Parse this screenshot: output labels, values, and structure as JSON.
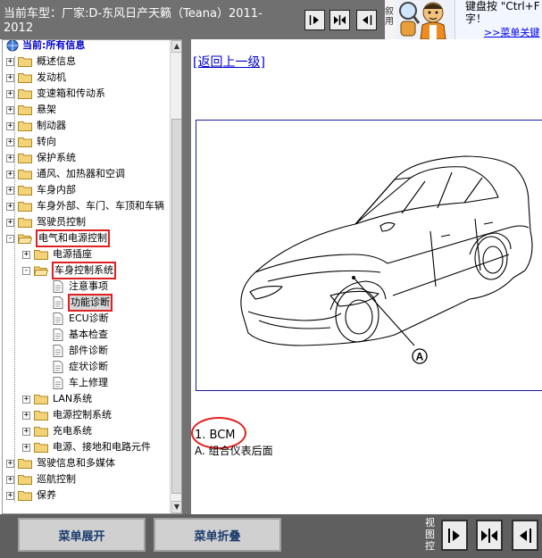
{
  "header": {
    "vehicle_line1": "当前车型：厂家:D-东风日产天籁（Teana）2011-",
    "vehicle_line2": "2012",
    "help_strip": "叙用",
    "help_text_line1": "键盘按 \"Ctrl+F",
    "help_text_line2": "字！",
    "help_link": ">>菜单关键",
    "buttons": [
      "expand-right-icon",
      "split-view-icon",
      "expand-left-icon"
    ]
  },
  "tree": {
    "root": "当前:所有信息",
    "items": [
      {
        "label": "概述信息",
        "expander": "+"
      },
      {
        "label": "发动机",
        "expander": "+"
      },
      {
        "label": "变速箱和传动系",
        "expander": "+"
      },
      {
        "label": "悬架",
        "expander": "+"
      },
      {
        "label": "制动器",
        "expander": "+"
      },
      {
        "label": "转向",
        "expander": "+"
      },
      {
        "label": "保护系统",
        "expander": "+"
      },
      {
        "label": "通风、加热器和空调",
        "expander": "+"
      },
      {
        "label": "车身内部",
        "expander": "+"
      },
      {
        "label": "车身外部、车门、车顶和车辆",
        "expander": "+"
      },
      {
        "label": "驾驶员控制",
        "expander": "+"
      },
      {
        "label": "电气和电源控制",
        "expander": "-"
      },
      {
        "label": "电源插座",
        "expander": "+"
      },
      {
        "label": "车身控制系统",
        "expander": "-"
      },
      {
        "label": "注意事项"
      },
      {
        "label": "功能诊断"
      },
      {
        "label": "ECU诊断"
      },
      {
        "label": "基本检查"
      },
      {
        "label": "部件诊断"
      },
      {
        "label": "症状诊断"
      },
      {
        "label": "车上修理"
      },
      {
        "label": "LAN系统",
        "expander": "+"
      },
      {
        "label": "电源控制系统",
        "expander": "+"
      },
      {
        "label": "充电系统",
        "expander": "+"
      },
      {
        "label": "电源、接地和电路元件",
        "expander": "+"
      },
      {
        "label": "驾驶信息和多媒体",
        "expander": "+"
      },
      {
        "label": "巡航控制",
        "expander": "+"
      },
      {
        "label": "保养",
        "expander": "+"
      }
    ]
  },
  "content": {
    "back_link": "[返回上一级]",
    "figure_callout": "A",
    "caption1": "1. BCM",
    "caption2": "A. 组合仪表后面"
  },
  "footer": {
    "expand_label": "菜单展开",
    "collapse_label": "菜单折叠",
    "view_label": "视图控",
    "view_buttons": [
      "expand-right-icon",
      "split-view-icon",
      "expand-left-icon"
    ]
  },
  "colors": {
    "highlight": "#e02020",
    "toolbar": "#707070",
    "footer": "#5f5f5f",
    "link": "#0000cc",
    "figure_border": "#1c1c9c"
  }
}
